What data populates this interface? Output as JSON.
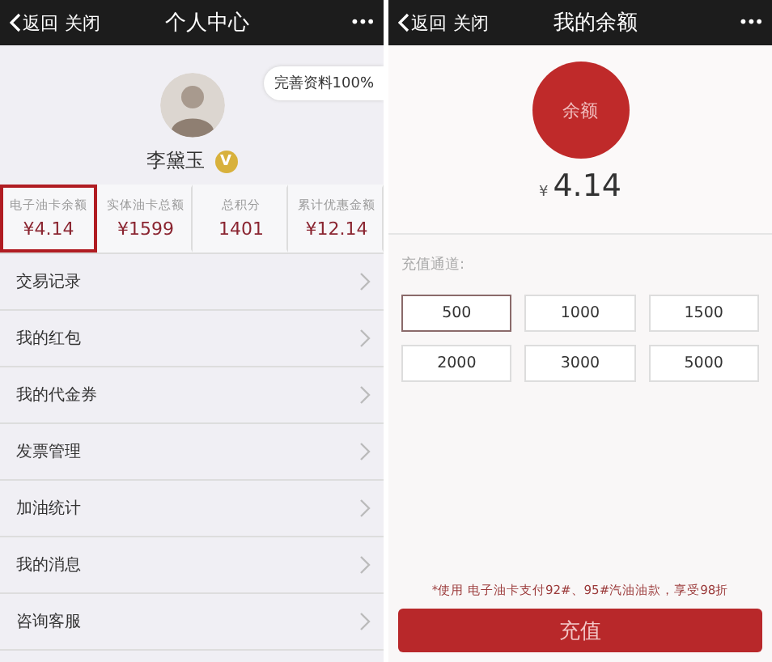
{
  "left_screen": {
    "nav": {
      "back": "返回",
      "close": "关闭",
      "title": "个人中心",
      "more": "•••"
    },
    "profile": {
      "complete_badge": "完善资料100%",
      "name": "李黛玉",
      "verified_mark": "V"
    },
    "stats": [
      {
        "label": "电子油卡余额",
        "value": "¥4.14",
        "selected": true
      },
      {
        "label": "实体油卡总额",
        "value": "¥1599",
        "selected": false
      },
      {
        "label": "总积分",
        "value": "1401",
        "selected": false
      },
      {
        "label": "累计优惠金额",
        "value": "¥12.14",
        "selected": false
      }
    ],
    "menu_items": [
      "交易记录",
      "我的红包",
      "我的代金券",
      "发票管理",
      "加油统计",
      "我的消息",
      "咨询客服"
    ]
  },
  "right_screen": {
    "nav": {
      "back": "返回",
      "close": "关闭",
      "title": "我的余额",
      "more": "•••"
    },
    "balance_badge": "余额",
    "currency": "¥",
    "balance": "4.14",
    "channel_label": "充值通道:",
    "amounts": [
      {
        "label": "500",
        "selected": true
      },
      {
        "label": "1000",
        "selected": false
      },
      {
        "label": "1500",
        "selected": false
      },
      {
        "label": "2000",
        "selected": false
      },
      {
        "label": "3000",
        "selected": false
      },
      {
        "label": "5000",
        "selected": false
      }
    ],
    "note": "*使用 电子油卡支付92#、95#汽油油款，享受98折",
    "recharge_button": "充值"
  }
}
